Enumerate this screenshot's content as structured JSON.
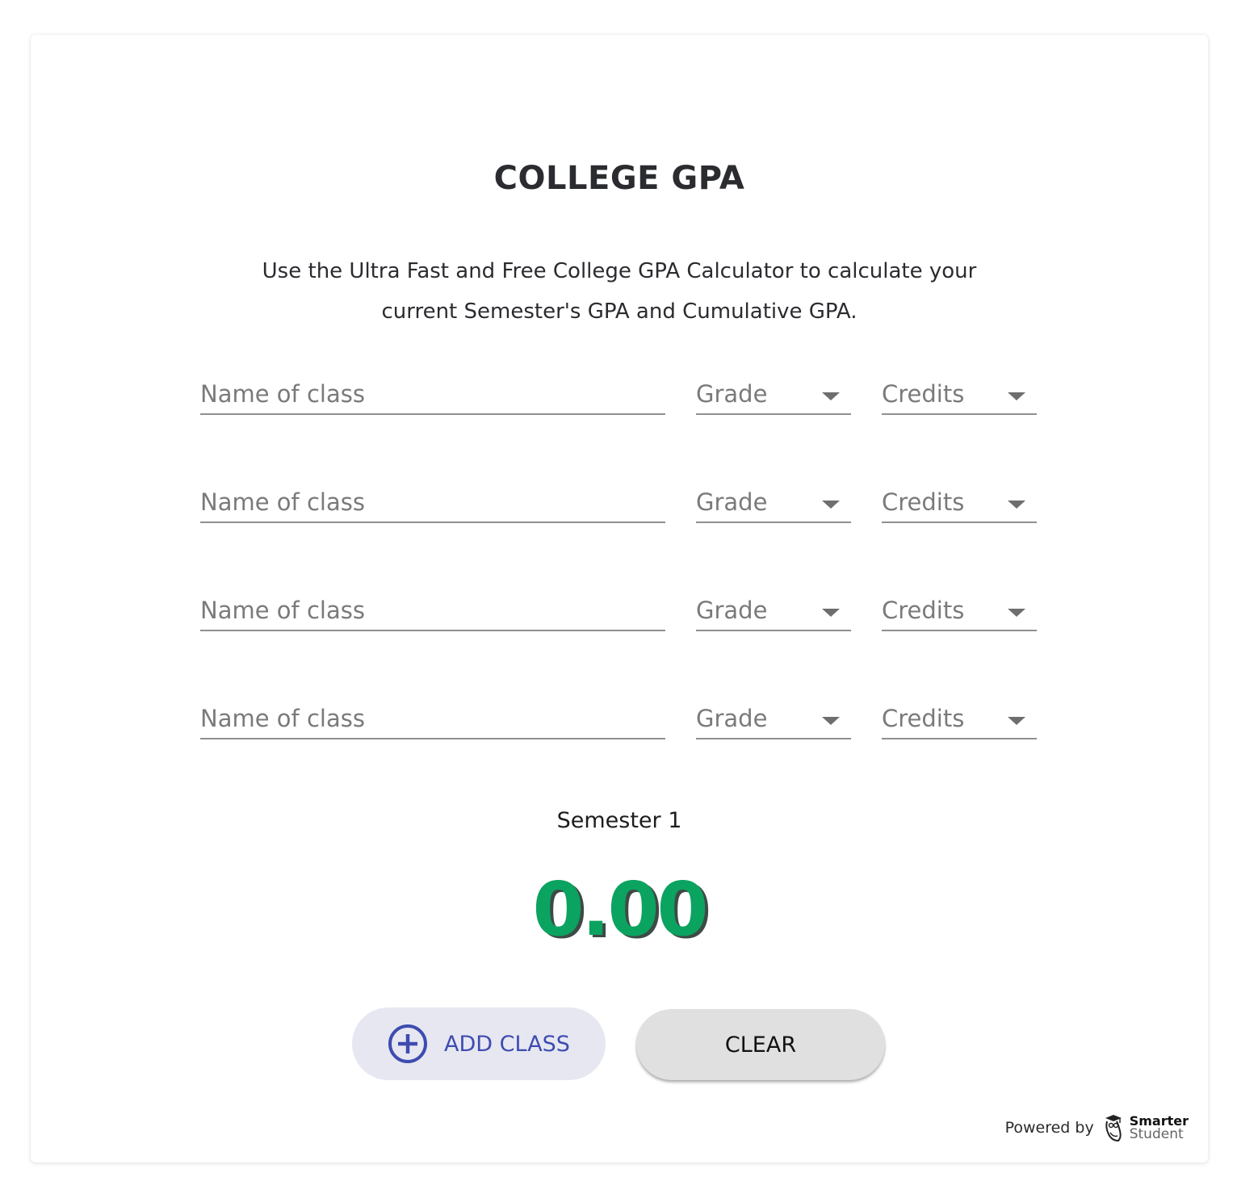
{
  "header": {
    "title": "COLLEGE GPA",
    "description": "Use the Ultra Fast and Free College GPA Calculator to calculate your current Semester's GPA and Cumulative GPA."
  },
  "classes": [
    {
      "name_placeholder": "Name of class",
      "name_value": "",
      "grade_label": "Grade",
      "credits_label": "Credits"
    },
    {
      "name_placeholder": "Name of class",
      "name_value": "",
      "grade_label": "Grade",
      "credits_label": "Credits"
    },
    {
      "name_placeholder": "Name of class",
      "name_value": "",
      "grade_label": "Grade",
      "credits_label": "Credits"
    },
    {
      "name_placeholder": "Name of class",
      "name_value": "",
      "grade_label": "Grade",
      "credits_label": "Credits"
    }
  ],
  "result": {
    "semester_label": "Semester 1",
    "gpa": "0.00",
    "gpa_color": "#0ba360"
  },
  "actions": {
    "add_class_label": "ADD CLASS",
    "add_class_icon": "plus-circle-icon",
    "clear_label": "CLEAR"
  },
  "footer": {
    "powered_by": "Powered by",
    "brand_line1": "Smarter",
    "brand_line2": "Student",
    "brand_icon": "owl-graduate-icon"
  },
  "colors": {
    "accent": "#3e4cb0",
    "add_button_bg": "#e6e7f1",
    "clear_button_bg": "#e0e0e0",
    "gpa_green": "#0ba360"
  }
}
